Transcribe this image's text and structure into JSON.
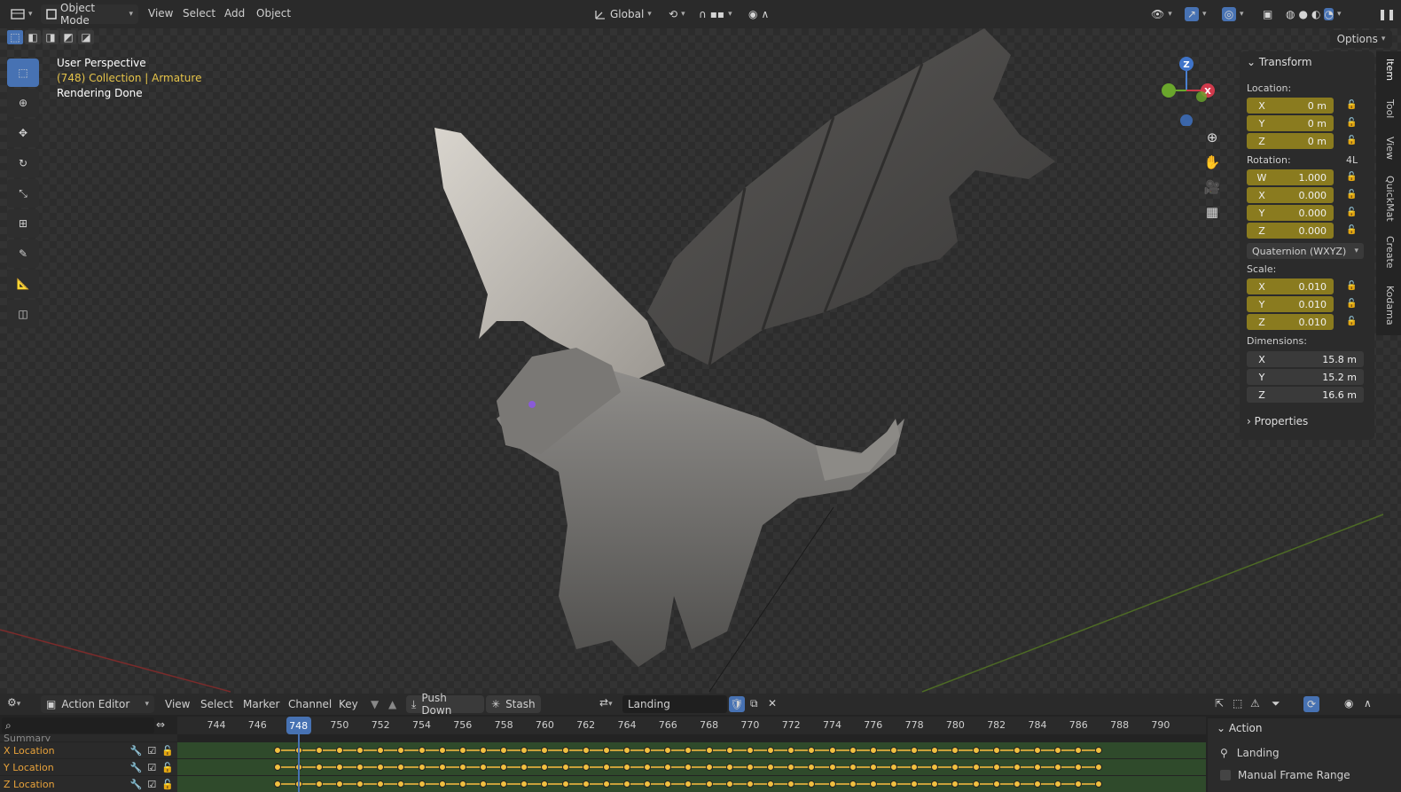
{
  "header": {
    "mode_label": "Object Mode",
    "menu": [
      "View",
      "Select",
      "Add",
      "Object"
    ],
    "orientation_label": "Global",
    "options_label": "Options"
  },
  "viewport": {
    "info_lines": [
      "User Perspective",
      "(748) Collection | Armature",
      "Rendering Done"
    ],
    "gizmo_axes": [
      "Z",
      "X"
    ]
  },
  "npanel": {
    "section_transform": "Transform",
    "location_label": "Location:",
    "location": [
      {
        "axis": "X",
        "value": "0 m"
      },
      {
        "axis": "Y",
        "value": "0 m"
      },
      {
        "axis": "Z",
        "value": "0 m"
      }
    ],
    "rotation_label": "Rotation:",
    "rotation_mode_badge": "4L",
    "rotation": [
      {
        "axis": "W",
        "value": "1.000"
      },
      {
        "axis": "X",
        "value": "0.000"
      },
      {
        "axis": "Y",
        "value": "0.000"
      },
      {
        "axis": "Z",
        "value": "0.000"
      }
    ],
    "rotation_mode": "Quaternion (WXYZ)",
    "scale_label": "Scale:",
    "scale": [
      {
        "axis": "X",
        "value": "0.010"
      },
      {
        "axis": "Y",
        "value": "0.010"
      },
      {
        "axis": "Z",
        "value": "0.010"
      }
    ],
    "dimensions_label": "Dimensions:",
    "dimensions": [
      {
        "axis": "X",
        "value": "15.8 m"
      },
      {
        "axis": "Y",
        "value": "15.2 m"
      },
      {
        "axis": "Z",
        "value": "16.6 m"
      }
    ],
    "section_properties": "Properties",
    "side_tabs": [
      "Item",
      "Tool",
      "View",
      "QuickMat",
      "Create",
      "Kodama"
    ]
  },
  "action_editor": {
    "editor_label": "Action Editor",
    "menu": [
      "View",
      "Select",
      "Marker",
      "Channel",
      "Key"
    ],
    "push_down_label": "Push Down",
    "stash_label": "Stash",
    "action_name": "Landing",
    "current_frame": "748",
    "frame_ticks": [
      "744",
      "746",
      "748",
      "750",
      "752",
      "754",
      "756",
      "758",
      "760",
      "762",
      "764",
      "766",
      "768",
      "770",
      "772",
      "774",
      "776",
      "778",
      "780",
      "782",
      "784",
      "786",
      "788",
      "790"
    ],
    "channels": [
      "Summary",
      "X Location",
      "Y Location",
      "Z Location"
    ],
    "side_panel": {
      "title": "Action",
      "action_name": "Landing",
      "manual_range_label": "Manual Frame Range"
    }
  },
  "colors": {
    "accent_blue": "#4772b3",
    "field_yellow": "#8a7b1f",
    "channel_orange": "#e8a23a",
    "keyframe": "#f0c040"
  }
}
